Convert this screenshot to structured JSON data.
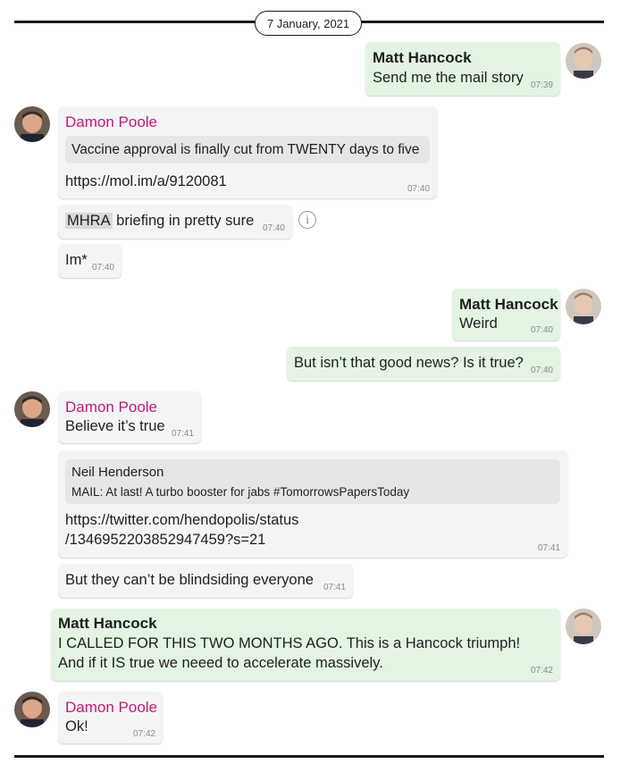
{
  "date": "7 January, 2021",
  "info_icon_glyph": "i",
  "messages": [
    {
      "sender": "Matt Hancock",
      "text": "Send me the mail story",
      "time": "07:39"
    },
    {
      "sender": "Damon Poole",
      "quote": "Vaccine approval is finally cut from TWENTY days to five",
      "text": "https://mol.im/a/9120081",
      "time": "07:40"
    },
    {
      "highlight": "MHRA",
      "text": " briefing in pretty sure",
      "time": "07:40"
    },
    {
      "text": "Im*",
      "time": "07:40"
    },
    {
      "sender": "Matt Hancock",
      "text": "Weird",
      "time": "07:40"
    },
    {
      "text": "But isn’t that good news? Is it true?",
      "time": "07:40"
    },
    {
      "sender": "Damon Poole",
      "text": "Believe it’s true",
      "time": "07:41"
    },
    {
      "quote_author": "Neil Henderson",
      "quote": "MAIL: At last! A turbo booster for jabs #TomorrowsPapersToday",
      "line1": "https://twitter.com/hendopolis/status",
      "line2": "/1346952203852947459?s=21",
      "time": "07:41"
    },
    {
      "text": "But they can’t be blindsiding everyone",
      "time": "07:41"
    },
    {
      "sender": "Matt Hancock",
      "line1": "I CALLED FOR THIS TWO MONTHS AGO. This is a Hancock triumph!",
      "line2": "And if it IS true we neeed to accelerate massively.",
      "time": "07:42"
    },
    {
      "sender": "Damon Poole",
      "text": "Ok!",
      "time": "07:42"
    }
  ],
  "colors": {
    "incoming_bubble": "#f4f4f4",
    "outgoing_bubble": "#e3f4e3",
    "incoming_name": "#c2187a"
  },
  "avatars": {
    "damon": "avatar-damon-poole",
    "matt": "avatar-matt-hancock"
  }
}
